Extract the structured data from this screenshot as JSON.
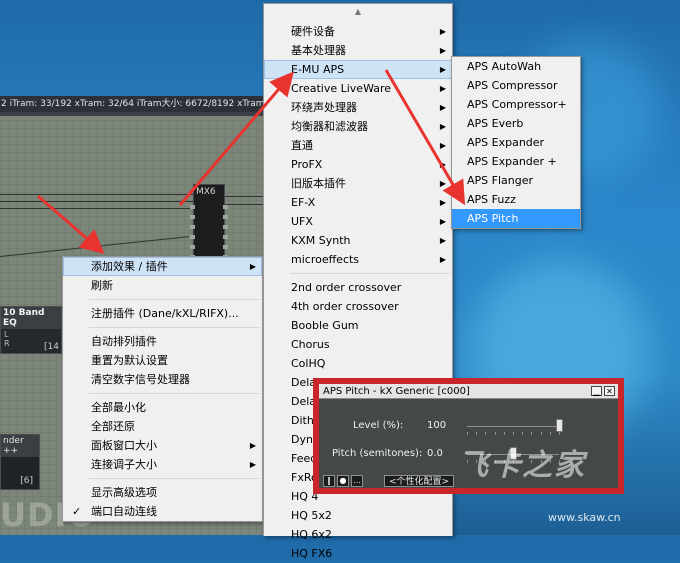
{
  "dsp": {
    "status_text": "2 iTram: 33/192 xTram: 32/64 iTram大小: 6672/8192 xTram大小:",
    "mx6_label": "MX6",
    "eq_title": "10 Band EQ",
    "eq_lr": "L\nR",
    "eq_num": "[14",
    "der_title": "nder ++",
    "der_num": "[6]",
    "big_text": "UDIO"
  },
  "main_menu": {
    "items": [
      {
        "label": "添加效果 / 插件",
        "arrow": true,
        "selected": true
      },
      {
        "label": "刷新"
      },
      {
        "sep": true
      },
      {
        "label": "注册插件 (Dane/kXL/RIFX)..."
      },
      {
        "sep": true
      },
      {
        "label": "自动排列插件"
      },
      {
        "label": "重置为默认设置"
      },
      {
        "label": "清空数字信号处理器"
      },
      {
        "sep": true
      },
      {
        "label": "全部最小化"
      },
      {
        "label": "全部还原"
      },
      {
        "label": "面板窗口大小",
        "arrow": true
      },
      {
        "label": "连接调子大小",
        "arrow": true
      },
      {
        "sep": true
      },
      {
        "label": "显示高级选项"
      },
      {
        "label": "端口自动连线",
        "checked": true
      }
    ]
  },
  "plugin_menu": {
    "scroll_up": "▲",
    "items": [
      {
        "label": "硬件设备",
        "arrow": true
      },
      {
        "label": "基本处理器",
        "arrow": true
      },
      {
        "label": "E-MU APS",
        "arrow": true,
        "selected": true
      },
      {
        "label": "Creative LiveWare",
        "arrow": true
      },
      {
        "label": "环绕声处理器",
        "arrow": true
      },
      {
        "label": "均衡器和滤波器",
        "arrow": true
      },
      {
        "label": "直通",
        "arrow": true
      },
      {
        "label": "ProFX",
        "arrow": true
      },
      {
        "label": "旧版本插件",
        "arrow": true
      },
      {
        "label": "EF-X",
        "arrow": true
      },
      {
        "label": "UFX",
        "arrow": true
      },
      {
        "label": "KXM Synth",
        "arrow": true
      },
      {
        "label": "microeffects",
        "arrow": true
      },
      {
        "sep": true
      },
      {
        "label": "2nd order crossover"
      },
      {
        "label": "4th order crossover"
      },
      {
        "label": "Booble Gum"
      },
      {
        "label": "Chorus"
      },
      {
        "label": "ColHQ"
      },
      {
        "label": "Delay A"
      },
      {
        "label": "Dela"
      },
      {
        "label": "Dithe"
      },
      {
        "label": "Dyna"
      },
      {
        "label": "Feed"
      },
      {
        "label": "FxRo"
      },
      {
        "label": "HQ 4"
      },
      {
        "label": "HQ 5x2"
      },
      {
        "label": "HQ 6x2"
      },
      {
        "label": "HQ FX6"
      }
    ]
  },
  "aps_menu": {
    "items": [
      {
        "label": "APS AutoWah"
      },
      {
        "label": "APS Compressor"
      },
      {
        "label": "APS Compressor+"
      },
      {
        "label": "APS Everb"
      },
      {
        "label": "APS Expander"
      },
      {
        "label": "APS Expander +"
      },
      {
        "label": "APS Flanger"
      },
      {
        "label": "APS Fuzz"
      },
      {
        "label": "APS Pitch",
        "highlighted": true
      }
    ]
  },
  "aps_dialog": {
    "title": "APS Pitch - kX Generic [c000]",
    "minimize_glyph": "▁",
    "close_glyph": "✕",
    "level_label": "Level (%):",
    "level_value": "100",
    "level_fraction": 1.0,
    "pitch_label": "Pitch (semitones):",
    "pitch_value": "0.0",
    "pitch_fraction": 0.5,
    "preset_label": "<个性化配置>",
    "tool_1": "‖",
    "tool_2": "●",
    "tool_3": "…"
  },
  "watermark": {
    "logo_text": "飞卡之家",
    "url": "www.skaw.cn"
  },
  "colors": {
    "annotation": "#e8332f",
    "highlight": "#3399ff",
    "menu_bg": "#f0f0f0"
  }
}
